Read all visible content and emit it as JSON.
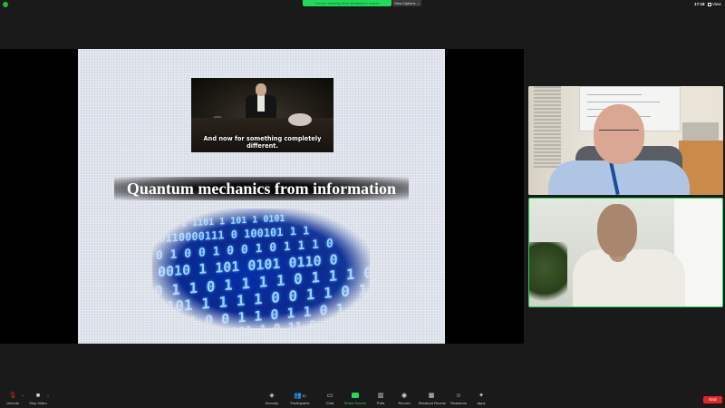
{
  "topbar": {
    "banner_text": "You are viewing Brian Bhattarai's screen",
    "view_options_label": "View Options ⌄",
    "time": "17:18",
    "view_label": "View"
  },
  "slide": {
    "image_caption": "And now for something completely different.",
    "title": "Quantum mechanics from information",
    "binary_rows": [
      "1 1 1101 1 101 1 0101",
      "10110000111 0 100101 1 1",
      "0 1 0 0 1 0 0 1 0 1 1 1 0",
      "0010 1 101 0101 0110 0",
      "0 1 1 0 1 1 1 1 0 1 1 1 0 1",
      "0101 1 1 1 1 0 0 1 1 0 1 0 1",
      "1 1 0 0 1 1 0 1 1 0 1 1 1",
      "011011101 1 0 11 0 1"
    ]
  },
  "toolbar": {
    "unmute": "Unmute",
    "stop_video": "Stop Video",
    "security": "Security",
    "participants": "Participants",
    "participants_count": "10",
    "chat": "Chat",
    "share_screen": "Share Screen",
    "polls": "Polls",
    "record": "Record",
    "breakout_rooms": "Breakout Rooms",
    "reactions": "Reactions",
    "apps": "Apps",
    "end": "End"
  },
  "colors": {
    "accent_green": "#23d959",
    "end_red": "#e02828",
    "background": "#1a1a1a"
  }
}
